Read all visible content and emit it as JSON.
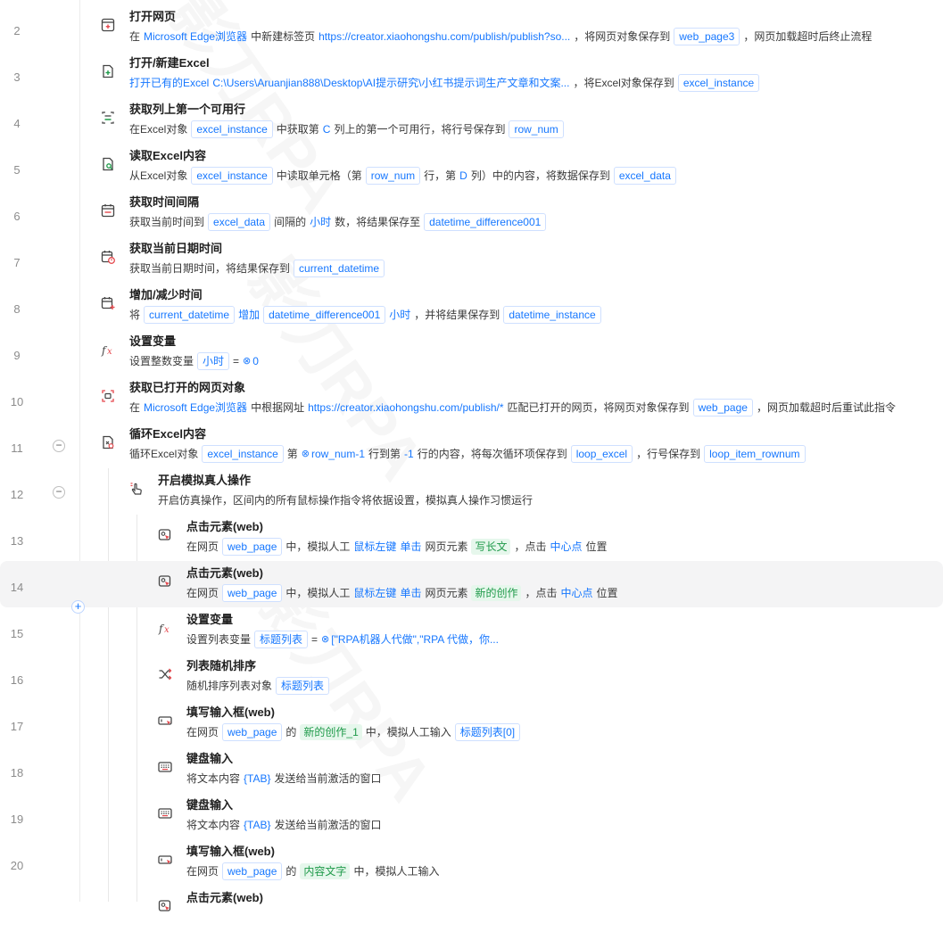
{
  "watermark": "影刀RPA",
  "steps": [
    {
      "line": "2",
      "title": "打开网页",
      "icon": "browser-open-icon",
      "desc": [
        {
          "k": "t",
          "v": "在"
        },
        {
          "k": "lk",
          "v": "Microsoft Edge浏览器"
        },
        {
          "k": "t",
          "v": "中新建标签页"
        },
        {
          "k": "lk",
          "v": "https://creator.xiaohongshu.com/publish/publish?so..."
        },
        {
          "k": "t",
          "v": "，将网页对象保存到"
        },
        {
          "k": "var",
          "v": "web_page3"
        },
        {
          "k": "t",
          "v": "，网页加载超时后终止流程"
        }
      ]
    },
    {
      "line": "3",
      "title": "打开/新建Excel",
      "icon": "excel-open-icon",
      "desc": [
        {
          "k": "lk",
          "v": "打开已有的Excel"
        },
        {
          "k": "lk",
          "v": "C:\\Users\\Aruanjian888\\Desktop\\AI提示研究\\小红书提示词生产文章和文案..."
        },
        {
          "k": "t",
          "v": "，将Excel对象保存到"
        },
        {
          "k": "var",
          "v": "excel_instance"
        }
      ]
    },
    {
      "line": "4",
      "title": "获取列上第一个可用行",
      "icon": "excel-row-icon",
      "desc": [
        {
          "k": "t",
          "v": "在Excel对象"
        },
        {
          "k": "var",
          "v": "excel_instance"
        },
        {
          "k": "t",
          "v": "中获取第"
        },
        {
          "k": "lk",
          "v": "C"
        },
        {
          "k": "t",
          "v": "列上的第一个可用行，将行号保存到"
        },
        {
          "k": "var",
          "v": "row_num"
        }
      ]
    },
    {
      "line": "5",
      "title": "读取Excel内容",
      "icon": "excel-read-icon",
      "desc": [
        {
          "k": "t",
          "v": "从Excel对象"
        },
        {
          "k": "var",
          "v": "excel_instance"
        },
        {
          "k": "t",
          "v": "中读取单元格（第"
        },
        {
          "k": "var",
          "v": "row_num"
        },
        {
          "k": "t",
          "v": "行，第"
        },
        {
          "k": "lk",
          "v": "D"
        },
        {
          "k": "t",
          "v": "列）中的内容，将数据保存到"
        },
        {
          "k": "var",
          "v": "excel_data"
        }
      ]
    },
    {
      "line": "6",
      "title": "获取时间间隔",
      "icon": "calendar-interval-icon",
      "desc": [
        {
          "k": "t",
          "v": "获取当前时间到"
        },
        {
          "k": "var",
          "v": "excel_data"
        },
        {
          "k": "t",
          "v": "间隔的"
        },
        {
          "k": "lk",
          "v": "小时"
        },
        {
          "k": "t",
          "v": "数，将结果保存至"
        },
        {
          "k": "var",
          "v": "datetime_difference001"
        }
      ]
    },
    {
      "line": "7",
      "title": "获取当前日期时间",
      "icon": "calendar-clock-icon",
      "desc": [
        {
          "k": "t",
          "v": "获取当前日期时间，将结果保存到"
        },
        {
          "k": "var",
          "v": "current_datetime"
        }
      ]
    },
    {
      "line": "8",
      "title": "增加/减少时间",
      "icon": "calendar-add-icon",
      "desc": [
        {
          "k": "t",
          "v": "将"
        },
        {
          "k": "var",
          "v": "current_datetime"
        },
        {
          "k": "lk",
          "v": "增加"
        },
        {
          "k": "var",
          "v": "datetime_difference001"
        },
        {
          "k": "lk",
          "v": "小时"
        },
        {
          "k": "t",
          "v": "，并将结果保存到"
        },
        {
          "k": "var",
          "v": "datetime_instance"
        }
      ]
    },
    {
      "line": "9",
      "title": "设置变量",
      "icon": "fx-icon",
      "desc": [
        {
          "k": "t",
          "v": "设置整数变量"
        },
        {
          "k": "var",
          "v": "小时"
        },
        {
          "k": "t",
          "v": "="
        },
        {
          "k": "expr",
          "v": "0"
        }
      ]
    },
    {
      "line": "10",
      "title": "获取已打开的网页对象",
      "icon": "web-target-icon",
      "desc": [
        {
          "k": "t",
          "v": "在"
        },
        {
          "k": "lk",
          "v": "Microsoft Edge浏览器"
        },
        {
          "k": "t",
          "v": "中根据网址"
        },
        {
          "k": "lk",
          "v": "https://creator.xiaohongshu.com/publish/*"
        },
        {
          "k": "t",
          "v": "匹配已打开的网页，将网页对象保存到"
        },
        {
          "k": "var",
          "v": "web_page"
        },
        {
          "k": "t",
          "v": "，网页加载超时后重试此指令"
        }
      ]
    },
    {
      "line": "11",
      "title": "循环Excel内容",
      "icon": "excel-loop-icon",
      "toggle": "−",
      "desc": [
        {
          "k": "t",
          "v": "循环Excel对象"
        },
        {
          "k": "var",
          "v": "excel_instance"
        },
        {
          "k": "t",
          "v": "第"
        },
        {
          "k": "expr",
          "v": "row_num-1"
        },
        {
          "k": "t",
          "v": "行到第"
        },
        {
          "k": "lk",
          "v": "-1"
        },
        {
          "k": "t",
          "v": "行的内容，将每次循环项保存到"
        },
        {
          "k": "var",
          "v": "loop_excel"
        },
        {
          "k": "t",
          "v": "，行号保存到"
        },
        {
          "k": "var",
          "v": "loop_item_rownum"
        }
      ]
    },
    {
      "line": "12",
      "title": "开启模拟真人操作",
      "icon": "hand-pointer-icon",
      "toggle": "−",
      "desc": [
        {
          "k": "t",
          "v": "开启仿真操作，区间内的所有鼠标操作指令将依据设置，模拟真人操作习惯运行"
        }
      ]
    },
    {
      "line": "13",
      "title": "点击元素(web)",
      "icon": "click-element-icon",
      "desc": [
        {
          "k": "t",
          "v": "在网页"
        },
        {
          "k": "var",
          "v": "web_page"
        },
        {
          "k": "t",
          "v": "中，模拟人工"
        },
        {
          "k": "lk",
          "v": "鼠标左键"
        },
        {
          "k": "lk",
          "v": "单击"
        },
        {
          "k": "t",
          "v": "网页元素"
        },
        {
          "k": "grn",
          "v": "写长文"
        },
        {
          "k": "t",
          "v": "，点击"
        },
        {
          "k": "lk",
          "v": "中心点"
        },
        {
          "k": "t",
          "v": "位置"
        }
      ]
    },
    {
      "line": "14",
      "title": "点击元素(web)",
      "icon": "click-element-icon",
      "highlight": true,
      "desc": [
        {
          "k": "t",
          "v": "在网页"
        },
        {
          "k": "var",
          "v": "web_page"
        },
        {
          "k": "t",
          "v": "中，模拟人工"
        },
        {
          "k": "lk",
          "v": "鼠标左键"
        },
        {
          "k": "lk",
          "v": "单击"
        },
        {
          "k": "t",
          "v": "网页元素"
        },
        {
          "k": "grn",
          "v": "新的创作"
        },
        {
          "k": "t",
          "v": "，点击"
        },
        {
          "k": "lk",
          "v": "中心点"
        },
        {
          "k": "t",
          "v": "位置"
        }
      ]
    },
    {
      "line": "15",
      "title": "设置变量",
      "icon": "fx-icon",
      "desc": [
        {
          "k": "t",
          "v": "设置列表变量"
        },
        {
          "k": "var",
          "v": "标题列表"
        },
        {
          "k": "t",
          "v": "="
        },
        {
          "k": "expr",
          "v": "[\"RPA机器人代做\",\"RPA 代做，你..."
        }
      ]
    },
    {
      "line": "16",
      "title": "列表随机排序",
      "icon": "shuffle-icon",
      "desc": [
        {
          "k": "t",
          "v": "随机排序列表对象"
        },
        {
          "k": "var",
          "v": "标题列表"
        }
      ]
    },
    {
      "line": "17",
      "title": "填写输入框(web)",
      "icon": "input-field-icon",
      "desc": [
        {
          "k": "t",
          "v": "在网页"
        },
        {
          "k": "var",
          "v": "web_page"
        },
        {
          "k": "t",
          "v": "的"
        },
        {
          "k": "grn",
          "v": "新的创作_1"
        },
        {
          "k": "t",
          "v": "中，模拟人工输入"
        },
        {
          "k": "var",
          "v": "标题列表[0]"
        }
      ]
    },
    {
      "line": "18",
      "title": "键盘输入",
      "icon": "keyboard-icon",
      "desc": [
        {
          "k": "t",
          "v": "将文本内容"
        },
        {
          "k": "lk",
          "v": "{TAB}"
        },
        {
          "k": "t",
          "v": "发送给当前激活的窗口"
        }
      ]
    },
    {
      "line": "19",
      "title": "键盘输入",
      "icon": "keyboard-icon",
      "desc": [
        {
          "k": "t",
          "v": "将文本内容"
        },
        {
          "k": "lk",
          "v": "{TAB}"
        },
        {
          "k": "t",
          "v": "发送给当前激活的窗口"
        }
      ]
    },
    {
      "line": "20",
      "title": "填写输入框(web)",
      "icon": "input-field-icon",
      "desc": [
        {
          "k": "t",
          "v": "在网页"
        },
        {
          "k": "var",
          "v": "web_page"
        },
        {
          "k": "t",
          "v": "的"
        },
        {
          "k": "grn",
          "v": "内容文字"
        },
        {
          "k": "t",
          "v": "中，模拟人工输入"
        }
      ]
    },
    {
      "line": "",
      "title": "点击元素(web)",
      "icon": "click-element-icon",
      "desc": []
    }
  ]
}
